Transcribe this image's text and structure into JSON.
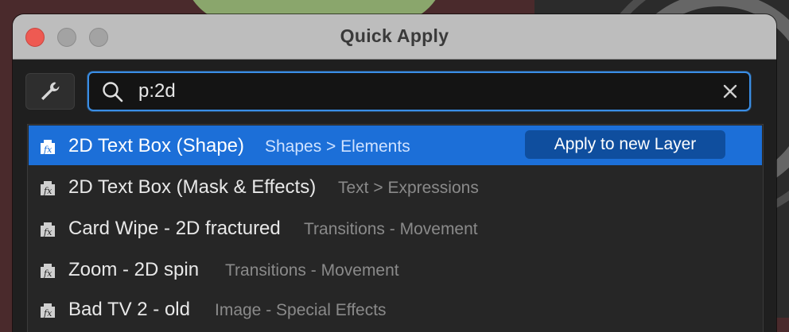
{
  "window": {
    "title": "Quick Apply"
  },
  "search": {
    "value": "p:2d"
  },
  "results": [
    {
      "name": "2D Text Box (Shape)",
      "category": "Shapes > Elements",
      "selected": true
    },
    {
      "name": "2D Text Box (Mask & Effects)",
      "category": "Text > Expressions",
      "selected": false
    },
    {
      "name": "Card Wipe - 2D fractured",
      "category": "Transitions - Movement",
      "selected": false
    },
    {
      "name": "Zoom - 2D spin",
      "category": "Transitions - Movement",
      "selected": false
    },
    {
      "name": "Bad TV 2 - old",
      "category": "Image - Special Effects",
      "selected": false
    }
  ],
  "apply_button": {
    "label": "Apply to new Layer"
  },
  "icons": {
    "settings": "wrench-icon",
    "search": "search-icon",
    "clear": "close-icon",
    "result": "fx-effect-icon"
  },
  "colors": {
    "accent": "#1c6fd8",
    "focus_ring": "#3a8ee6",
    "apply_button": "#0f4e9e"
  }
}
